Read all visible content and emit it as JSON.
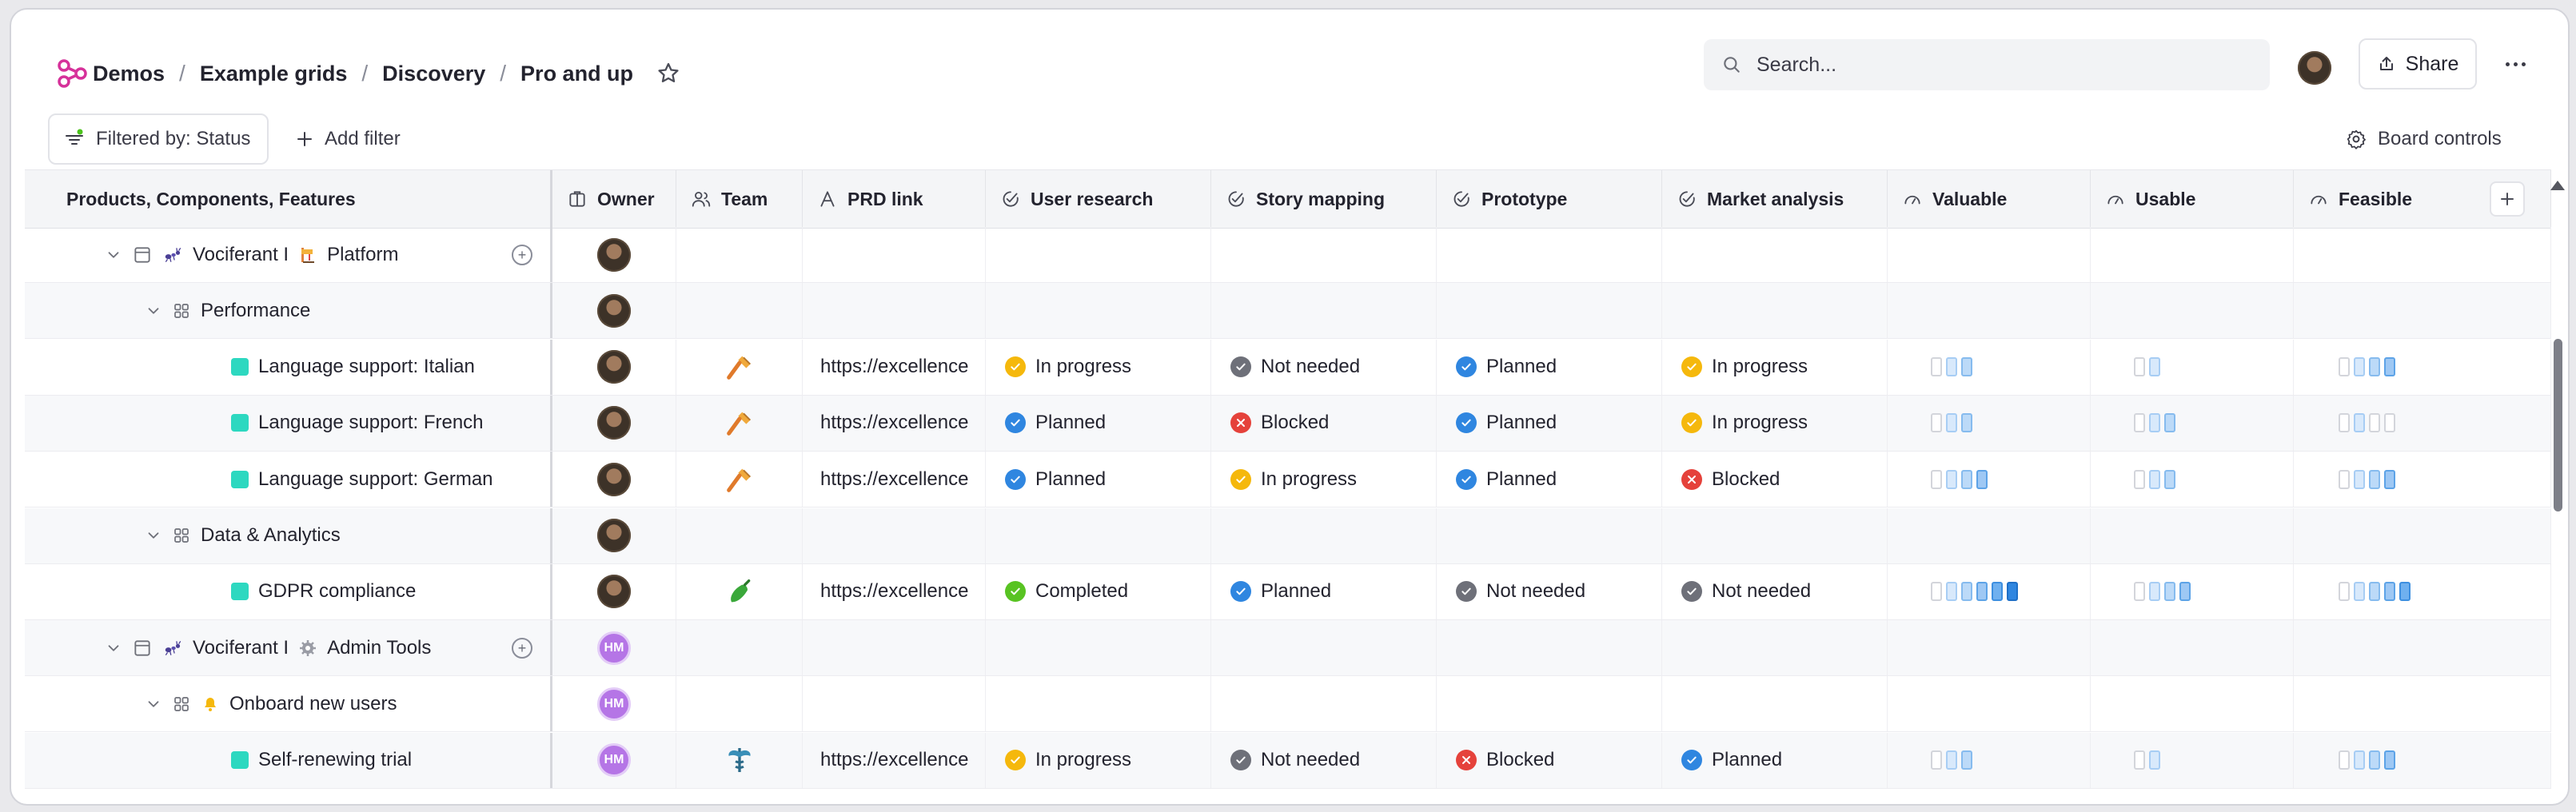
{
  "breadcrumb": [
    "Demos",
    "Example grids",
    "Discovery",
    "Pro and up"
  ],
  "search": {
    "placeholder": "Search..."
  },
  "header": {
    "share_label": "Share"
  },
  "toolbar": {
    "filter_label": "Filtered by: Status",
    "add_filter_label": "Add filter",
    "board_controls_label": "Board controls"
  },
  "columns": {
    "name": "Products, Components, Features",
    "owner": "Owner",
    "team": "Team",
    "prd": "PRD link",
    "research": "User research",
    "mapping": "Story mapping",
    "prototype": "Prototype",
    "market": "Market analysis",
    "valuable": "Valuable",
    "usable": "Usable",
    "feasible": "Feasible"
  },
  "status_colors": {
    "In progress": "#f5b80c",
    "Not needed": "#6e7079",
    "Planned": "#2f86e0",
    "Blocked": "#e5423b",
    "Completed": "#58c322"
  },
  "rows": [
    {
      "type": "product",
      "name_prefix": "Vociferant I",
      "name": "Platform",
      "owner": "photo"
    },
    {
      "type": "component",
      "name": "Performance",
      "owner": "photo"
    },
    {
      "type": "feature",
      "name": "Language support: Italian",
      "owner": "photo",
      "team_icon": "hammer-icon",
      "prd": "https://excellence",
      "research": "In progress",
      "mapping": "Not needed",
      "prototype": "Planned",
      "market": "In progress",
      "valuable": 2,
      "usable": 1,
      "feasible": 3
    },
    {
      "type": "feature",
      "name": "Language support: French",
      "owner": "photo",
      "team_icon": "hammer-icon",
      "prd": "https://excellence",
      "research": "Planned",
      "mapping": "Blocked",
      "prototype": "Planned",
      "market": "In progress",
      "valuable": 2,
      "usable": 2,
      "feasible": 1
    },
    {
      "type": "feature",
      "name": "Language support: German",
      "owner": "photo",
      "team_icon": "hammer-icon",
      "prd": "https://excellence",
      "research": "Planned",
      "mapping": "In progress",
      "prototype": "Planned",
      "market": "Blocked",
      "valuable": 3,
      "usable": 2,
      "feasible": 3
    },
    {
      "type": "component",
      "name": "Data & Analytics",
      "owner": "photo"
    },
    {
      "type": "feature",
      "name": "GDPR compliance",
      "owner": "photo",
      "team_icon": "pepper-icon",
      "prd": "https://excellence",
      "research": "Completed",
      "mapping": "Planned",
      "prototype": "Not needed",
      "market": "Not needed",
      "valuable": 5,
      "usable": 3,
      "feasible": 4
    },
    {
      "type": "product",
      "name_prefix": "Vociferant I",
      "name": "Admin Tools",
      "owner": "HM"
    },
    {
      "type": "component",
      "name": "Onboard new users",
      "owner": "HM"
    },
    {
      "type": "feature",
      "name": "Self-renewing trial",
      "owner": "HM",
      "team_icon": "caduceus-icon",
      "prd": "https://excellence",
      "research": "In progress",
      "mapping": "Not needed",
      "prototype": "Blocked",
      "market": "Planned",
      "valuable": 2,
      "usable": 1,
      "feasible": 3
    }
  ]
}
